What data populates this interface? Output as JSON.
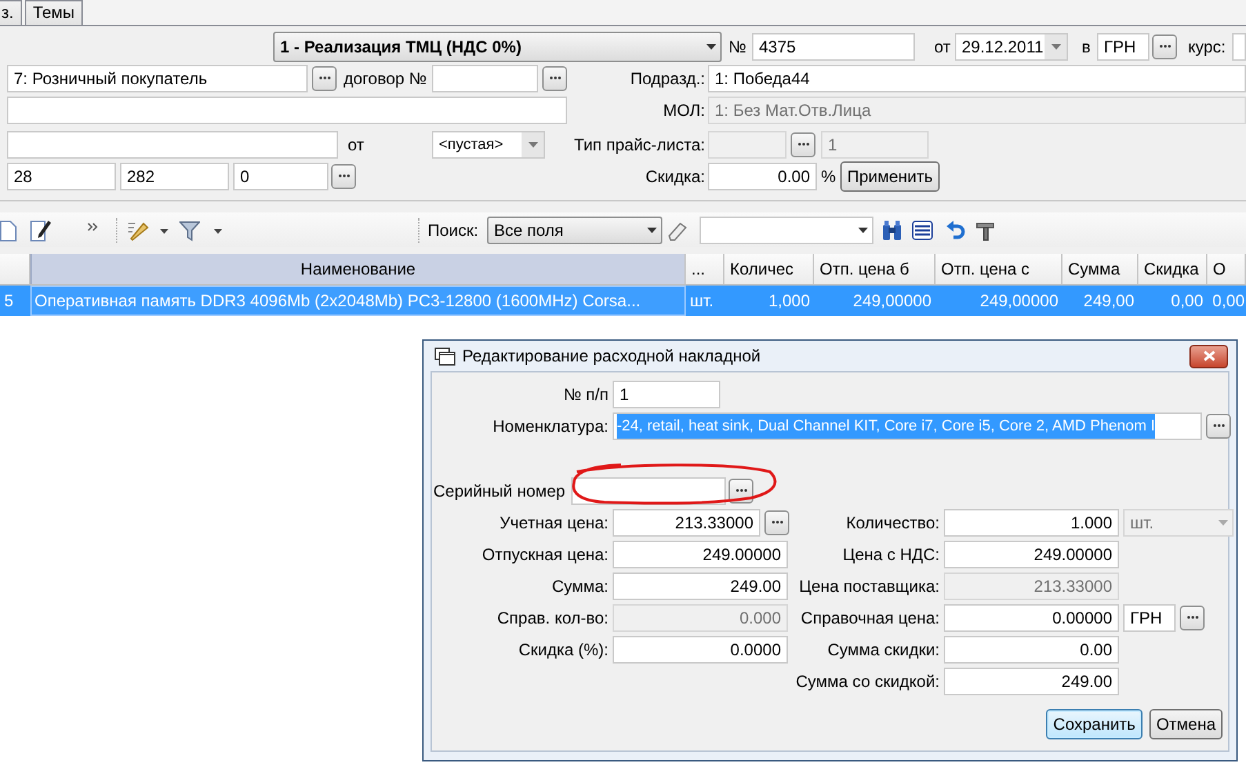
{
  "tabs": [
    {
      "label": "з.",
      "selected": false
    },
    {
      "label": "Темы",
      "selected": false
    }
  ],
  "document": {
    "operation": "1 - Реализация ТМЦ (НДС 0%)",
    "number_label": "№",
    "number": "4375",
    "date_label": "от",
    "date": "29.12.2011",
    "currency_label": "в",
    "currency": "ГРН",
    "rate_label": "курс:"
  },
  "counterparty": {
    "client": "7: Розничный покупатель",
    "contract_label": "договор №"
  },
  "division": {
    "label": "Подразд.:",
    "value": "1: Победа44"
  },
  "mol": {
    "label": "МОЛ:",
    "value": "1: Без Мат.Отв.Лица",
    "disabled": true
  },
  "basis": {
    "date_label": "от",
    "date": "<пустая>"
  },
  "price_list": {
    "label": "Тип прайс-листа:",
    "type_disabled": true,
    "value": "1",
    "value_disabled": true
  },
  "codes": [
    "28",
    "282",
    "0"
  ],
  "discount": {
    "label": "Скидка:",
    "value": "0.00",
    "unit": "%",
    "apply": "Применить"
  },
  "toolbar": {
    "search_label": "Поиск:",
    "search_field": "Все поля"
  },
  "table": {
    "columns": [
      "",
      "Наименование",
      "...",
      "Количес",
      "Отп. цена б",
      "Отп. цена с",
      "Сумма",
      "Скидка",
      "О"
    ],
    "rows": [
      {
        "selected": true,
        "cells": [
          "5",
          "Оперативная память DDR3 4096Mb (2x2048Mb) PC3-12800 (1600MHz) Corsa...",
          "шт.",
          "1,000",
          "249,00000",
          "249,00000",
          "249,00",
          "0,00",
          "0,00"
        ]
      }
    ]
  },
  "dialog": {
    "title": "Редактирование расходной накладной",
    "number": {
      "label": "№ п/п",
      "value": "1"
    },
    "nomenclature": {
      "label": "Номенклатура:",
      "value": "-24, retail, heat sink, Dual Channel KIT, Core i7, Core i5, Core 2, AMD Phenom I",
      "selected": true
    },
    "serial": {
      "label": "Серийный номер"
    },
    "rows": [
      {
        "left": {
          "label": "Учетная цена:",
          "value": "213.33000",
          "disabled": false,
          "extra": {
            "kind": "browse"
          }
        },
        "right": {
          "label": "Количество:",
          "value": "1.000",
          "disabled": false,
          "extra": {
            "kind": "unit",
            "value": "шт.",
            "disabled": true
          }
        }
      },
      {
        "left": {
          "label": "Отпускная цена:",
          "value": "249.00000",
          "disabled": false
        },
        "right": {
          "label": "Цена с НДС:",
          "value": "249.00000",
          "disabled": false
        }
      },
      {
        "left": {
          "label": "Сумма:",
          "value": "249.00",
          "disabled": false
        },
        "right": {
          "label": "Цена поставщика:",
          "value": "213.33000",
          "disabled": true
        }
      },
      {
        "left": {
          "label": "Справ. кол-во:",
          "value": "0.000",
          "disabled": true
        },
        "right": {
          "label": "Справочная цена:",
          "value": "0.00000",
          "disabled": false,
          "extra": {
            "kind": "currency",
            "value": "ГРН"
          }
        }
      },
      {
        "left": {
          "label": "Скидка (%):",
          "value": "0.0000",
          "disabled": false
        },
        "right": {
          "label": "Сумма скидки:",
          "value": "0.00",
          "disabled": false
        }
      },
      {
        "right": {
          "label": "Сумма со скидкой:",
          "value": "249.00",
          "disabled": false
        }
      }
    ],
    "buttons": [
      {
        "label": "Сохранить",
        "default": true
      },
      {
        "label": "Отмена",
        "default": false
      }
    ]
  }
}
